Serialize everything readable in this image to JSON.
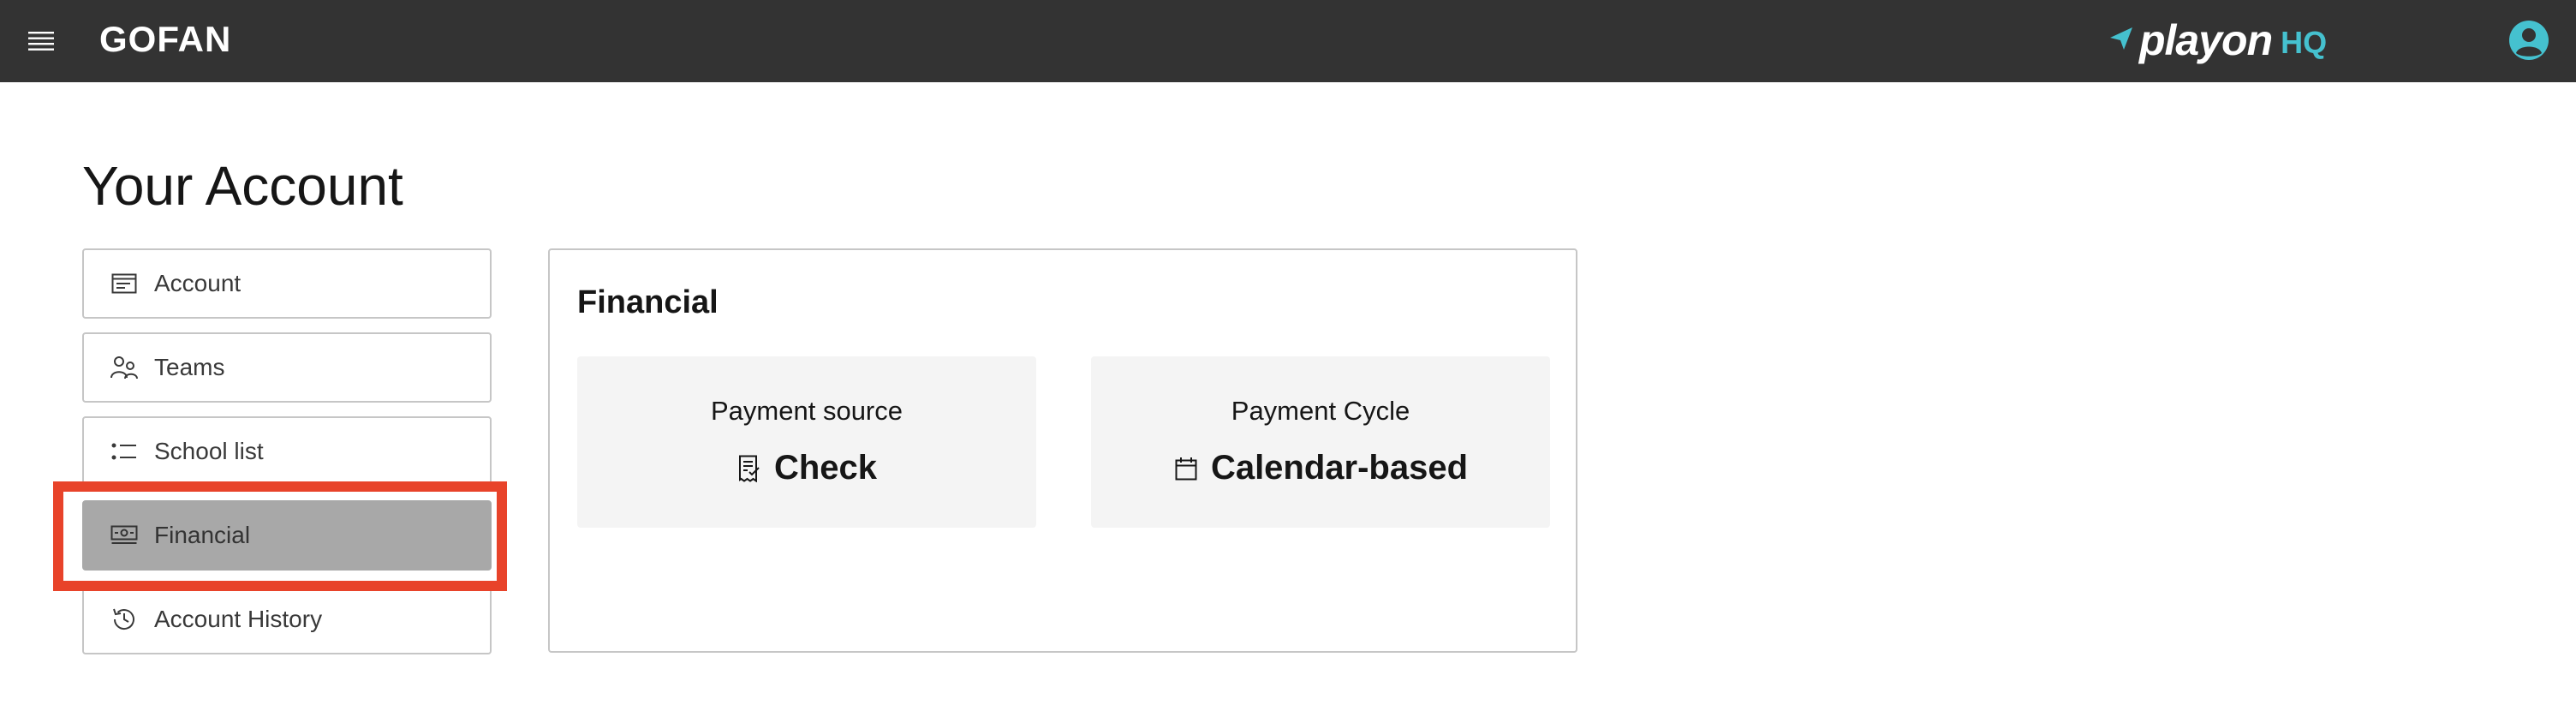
{
  "header": {
    "brand": "GOFAN",
    "logo_word": "playon",
    "logo_hq": "HQ",
    "menu_icon": "hamburger-menu-icon",
    "user_icon": "user-avatar-icon",
    "background": "#333333",
    "accent": "#45c1cf"
  },
  "page": {
    "title": "Your Account"
  },
  "sidebar": {
    "items": [
      {
        "label": "Account",
        "icon": "account-card-icon",
        "active": false
      },
      {
        "label": "Teams",
        "icon": "teams-icon",
        "active": false
      },
      {
        "label": "School list",
        "icon": "list-icon",
        "active": false
      },
      {
        "label": "Financial",
        "icon": "money-icon",
        "active": true
      },
      {
        "label": "Account History",
        "icon": "history-icon",
        "active": false
      }
    ],
    "highlight_color": "#e8432a"
  },
  "financial": {
    "title": "Financial",
    "payment_source": {
      "label": "Payment source",
      "value": "Check",
      "icon": "check-document-icon"
    },
    "payment_cycle": {
      "label": "Payment Cycle",
      "value": "Calendar-based",
      "icon": "calendar-icon"
    }
  }
}
